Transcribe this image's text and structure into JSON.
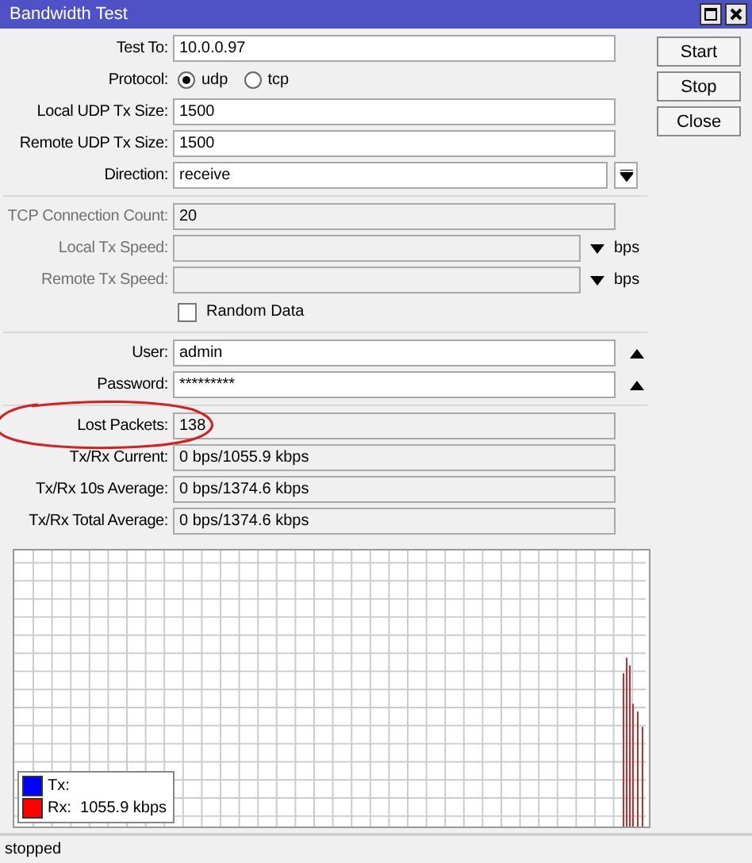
{
  "window": {
    "title": "Bandwidth Test"
  },
  "sections": [
    [
      {
        "kind": "text",
        "label": "Test To:",
        "value": "10.0.0.97",
        "disabled": false
      },
      {
        "kind": "radio",
        "label": "Protocol:",
        "options": [
          {
            "label": "udp",
            "selected": true
          },
          {
            "label": "tcp",
            "selected": false
          }
        ]
      },
      {
        "kind": "text",
        "label": "Local UDP Tx Size:",
        "value": "1500",
        "disabled": false
      },
      {
        "kind": "text",
        "label": "Remote UDP Tx Size:",
        "value": "1500",
        "disabled": false
      },
      {
        "kind": "select",
        "label": "Direction:",
        "value": "receive"
      }
    ],
    [
      {
        "kind": "text",
        "label": "TCP Connection Count:",
        "value": "20",
        "disabled": true
      },
      {
        "kind": "speed",
        "label": "Local Tx Speed:",
        "unit": "bps",
        "disabled": true
      },
      {
        "kind": "speed",
        "label": "Remote Tx Speed:",
        "unit": "bps",
        "disabled": true
      },
      {
        "kind": "checkbox",
        "label": "Random Data",
        "checked": false
      }
    ],
    [
      {
        "kind": "collapse",
        "label": "User:",
        "value": "admin"
      },
      {
        "kind": "collapse",
        "label": "Password:",
        "value": "*********"
      }
    ],
    [
      {
        "kind": "text",
        "label": "Lost Packets:",
        "value": "138",
        "disabled": true,
        "circled": true
      },
      {
        "kind": "text",
        "label": "Tx/Rx Current:",
        "value": "0 bps/1055.9 kbps",
        "disabled": true
      },
      {
        "kind": "text",
        "label": "Tx/Rx 10s Average:",
        "value": "0 bps/1374.6 kbps",
        "disabled": true
      },
      {
        "kind": "text",
        "label": "Tx/Rx Total Average:",
        "value": "0 bps/1374.6 kbps",
        "disabled": true
      }
    ]
  ],
  "buttons": [
    "Start",
    "Stop",
    "Close"
  ],
  "legend": [
    {
      "label": "Tx:",
      "color": "#0000ff"
    },
    {
      "label": "Rx:",
      "value": "1055.9 kbps",
      "color": "#ff0000"
    }
  ],
  "status_bar": "stopped"
}
